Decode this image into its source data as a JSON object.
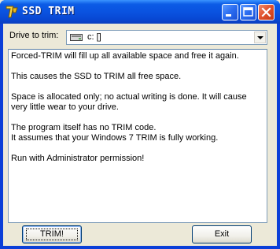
{
  "window": {
    "title": "SSD TRIM",
    "controls": {
      "minimize": "minimize-icon",
      "maximize": "maximize-icon",
      "close": "close-icon"
    }
  },
  "drive": {
    "label": "Drive to trim:",
    "selected": "c: []"
  },
  "info": {
    "line1": "Forced-TRIM will fill up all available space and free it again.",
    "line2": "This causes the SSD to TRIM all free space.",
    "line3": "Space is allocated only; no actual writing is done. It will cause very little wear to your drive.",
    "line4": "The program itself has no TRIM code.",
    "line5": "It assumes that your Windows 7 TRIM is fully working.",
    "line6": "Run with Administrator permission!"
  },
  "buttons": {
    "trim": "TRIM!",
    "exit": "Exit"
  },
  "colors": {
    "titlebar": "#0a53e0",
    "face": "#ece9d8",
    "close": "#e0502a"
  }
}
